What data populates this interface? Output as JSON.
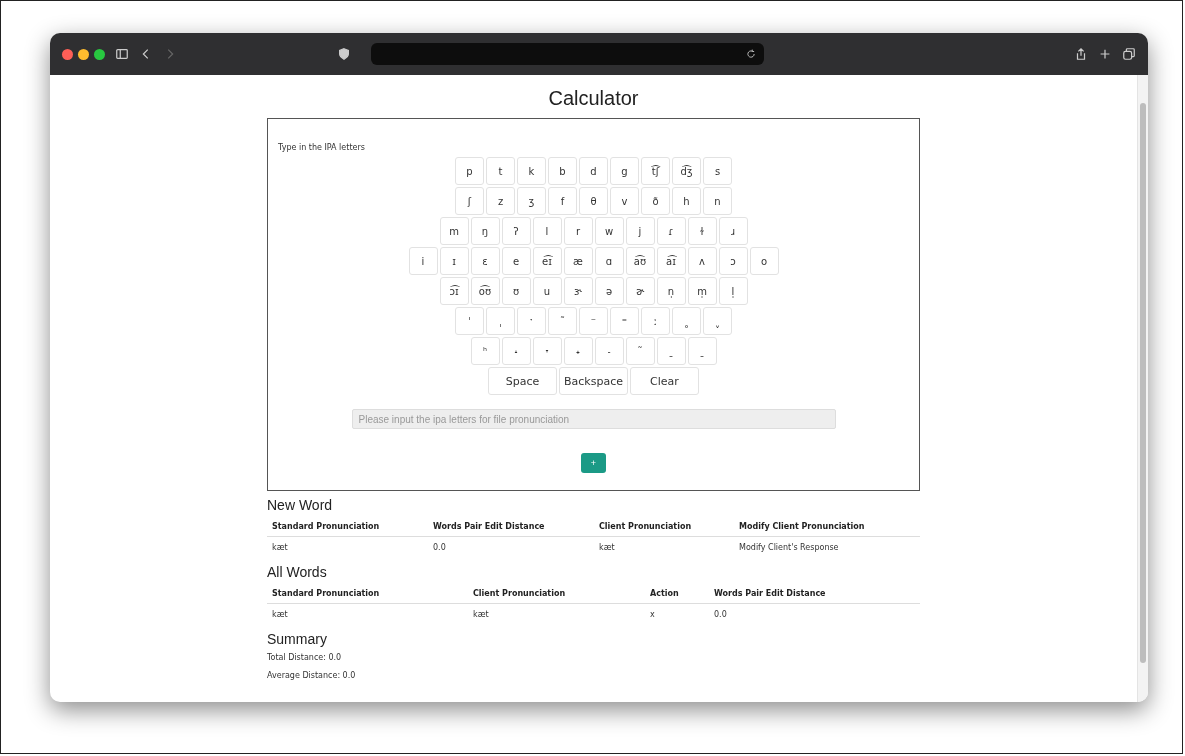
{
  "page": {
    "title": "Calculator"
  },
  "keyboard": {
    "instruction": "Type in the IPA letters",
    "rows": [
      [
        "p",
        "t",
        "k",
        "b",
        "d",
        "g",
        "t͡ʃ",
        "d͡ʒ",
        "s"
      ],
      [
        "ʃ",
        "z",
        "ʒ",
        "f",
        "θ",
        "v",
        "ð",
        "h",
        "n"
      ],
      [
        "m",
        "ŋ",
        "ʔ",
        "l",
        "r",
        "w",
        "j",
        "ɾ",
        "ɫ",
        "ɹ"
      ],
      [
        "i",
        "ɪ",
        "ɛ",
        "e",
        "e͡ɪ",
        "æ",
        "ɑ",
        "a͡ʊ",
        "a͡ɪ",
        "ʌ",
        "ɔ",
        "o"
      ],
      [
        "ɔ͡ɪ",
        "o͡ʊ",
        "ʊ",
        "u",
        "ɝ",
        "ə",
        "ɚ",
        "n̩",
        "m̩",
        "l̩"
      ],
      [
        "ˈ",
        "ˌ",
        "ˑ",
        "˜",
        "⁻",
        "⁼",
        "ː",
        "˳",
        "ˬ"
      ],
      [
        "ʰ",
        "˔",
        "˕",
        "˖",
        "˗",
        "˜",
        "ˍ",
        "ˍ"
      ]
    ],
    "actions": [
      "Space",
      "Backspace",
      "Clear"
    ],
    "input_placeholder": "Please input the ipa letters for file pronunciation",
    "add_button": "+"
  },
  "new_word": {
    "heading": "New Word",
    "columns": [
      "Standard Pronunciation",
      "Words Pair Edit Distance",
      "Client Pronunciation",
      "Modify Client Pronunciation"
    ],
    "rows": [
      [
        "kæt",
        "0.0",
        "kæt",
        "Modify Client's Response"
      ]
    ]
  },
  "all_words": {
    "heading": "All Words",
    "columns": [
      "Standard Pronunciation",
      "Client Pronunciation",
      "Action",
      "Words Pair Edit Distance"
    ],
    "rows": [
      [
        "kæt",
        "kæt",
        "x",
        "0.0"
      ]
    ]
  },
  "summary": {
    "heading": "Summary",
    "lines": [
      "Total Distance: 0.0",
      "Average Distance: 0.0"
    ]
  }
}
